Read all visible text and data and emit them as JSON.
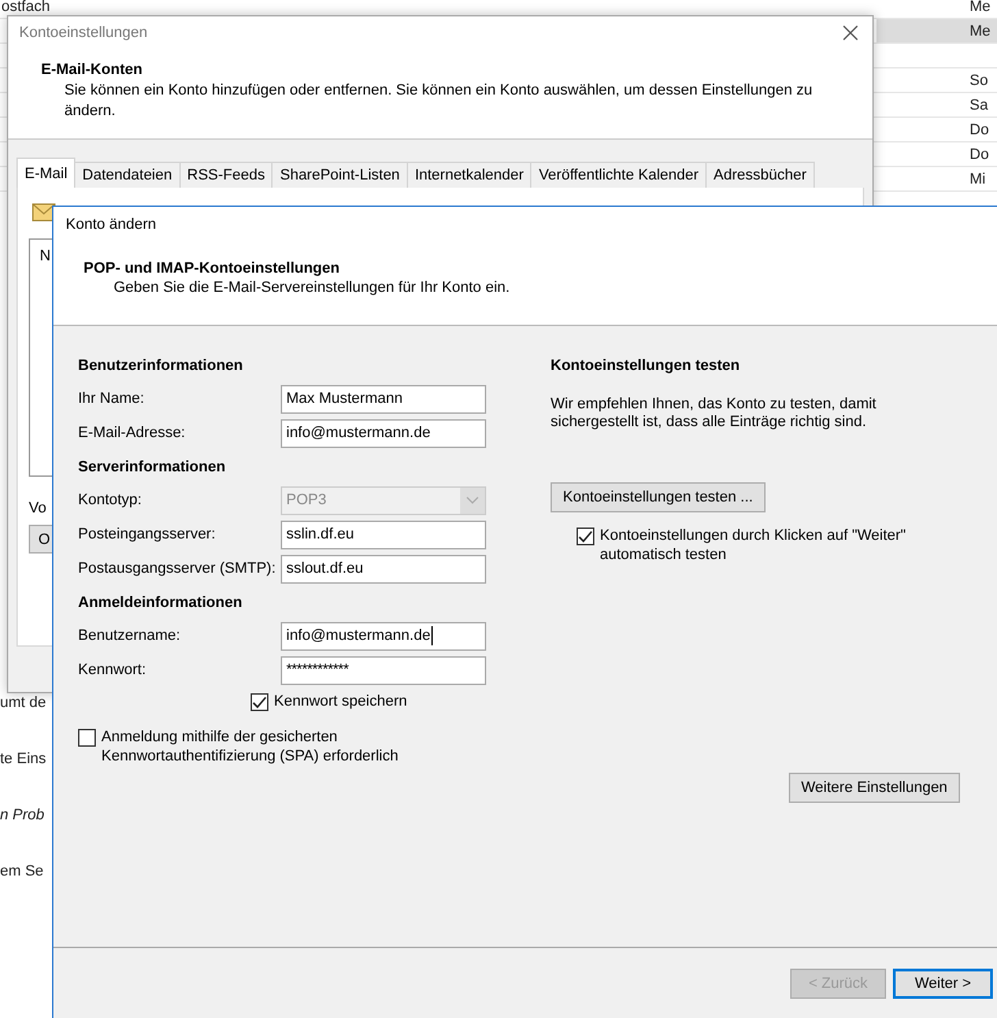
{
  "background": {
    "rows": [
      {
        "left": "ostfach",
        "right": "Me",
        "selected": false
      },
      {
        "right": "Me",
        "selected": true
      },
      {
        "selected": false
      },
      {
        "right": "So",
        "selected": false
      },
      {
        "right": "Sa",
        "selected": false
      },
      {
        "right": "Do",
        "selected": false
      },
      {
        "right": "Do",
        "selected": false
      },
      {
        "right": "Mi",
        "selected": false
      }
    ],
    "lines": [
      {
        "text": "umt de",
        "italic": false
      },
      {
        "text": "te Eins",
        "italic": false
      },
      {
        "text": "n Prob",
        "italic": true
      },
      {
        "text": "em Se",
        "italic": false
      }
    ]
  },
  "account_settings_window": {
    "title": "Kontoeinstellungen",
    "heading": "E-Mail-Konten",
    "description": "Sie können ein Konto hinzufügen oder entfernen. Sie können ein Konto auswählen, um dessen Einstellungen zu ändern.",
    "tabs": [
      {
        "label": "E-Mail",
        "selected": true
      },
      {
        "label": "Datendateien",
        "selected": false
      },
      {
        "label": "RSS-Feeds",
        "selected": false
      },
      {
        "label": "SharePoint-Listen",
        "selected": false
      },
      {
        "label": "Internetkalender",
        "selected": false
      },
      {
        "label": "Veröffentlichte Kalender",
        "selected": false
      },
      {
        "label": "Adressbücher",
        "selected": false
      }
    ],
    "list_header": "N",
    "label": "Vo",
    "button": "O"
  },
  "change_account_dialog": {
    "title": "Konto ändern",
    "heading": "POP- und IMAP-Kontoeinstellungen",
    "subtitle": "Geben Sie die E-Mail-Servereinstellungen für Ihr Konto ein.",
    "sections": [
      {
        "title": "Benutzerinformationen",
        "fields": [
          {
            "label": "Ihr Name:",
            "value": "Max Mustermann",
            "kind": "text",
            "disabled": false,
            "focused": false
          },
          {
            "label": "E-Mail-Adresse:",
            "value": "info@mustermann.de",
            "kind": "text",
            "disabled": false,
            "focused": false
          }
        ]
      },
      {
        "title": "Serverinformationen",
        "fields": [
          {
            "label": "Kontotyp:",
            "value": "POP3",
            "kind": "dropdown",
            "disabled": true,
            "focused": false
          },
          {
            "label": "Posteingangsserver:",
            "value": "sslin.df.eu",
            "kind": "text",
            "disabled": false,
            "focused": false
          },
          {
            "label": "Postausgangsserver (SMTP):",
            "value": "sslout.df.eu",
            "kind": "text",
            "disabled": false,
            "focused": false
          }
        ]
      },
      {
        "title": "Anmeldeinformationen",
        "fields": [
          {
            "label": "Benutzername:",
            "value": "info@mustermann.de",
            "kind": "text",
            "disabled": false,
            "focused": true
          },
          {
            "label": "Kennwort:",
            "value": "************",
            "kind": "password",
            "disabled": false,
            "focused": false
          }
        ]
      }
    ],
    "remember_password": {
      "label": "Kennwort speichern",
      "checked": true
    },
    "spa": {
      "label": "Anmeldung mithilfe der gesicherten Kennwortauthentifizierung (SPA) erforderlich",
      "checked": false
    },
    "test": {
      "title": "Kontoeinstellungen testen",
      "description": "Wir empfehlen Ihnen, das Konto zu testen, damit sichergestellt ist, dass alle Einträge richtig sind.",
      "button": "Kontoeinstellungen testen ...",
      "auto_test": {
        "label": "Kontoeinstellungen durch Klicken auf \"Weiter\" automatisch testen",
        "checked": true
      }
    },
    "more_settings": "Weitere Einstellungen",
    "buttons": [
      {
        "label": "< Zurück",
        "disabled": true,
        "default": false
      },
      {
        "label": "Weiter >",
        "disabled": false,
        "default": true
      }
    ]
  }
}
